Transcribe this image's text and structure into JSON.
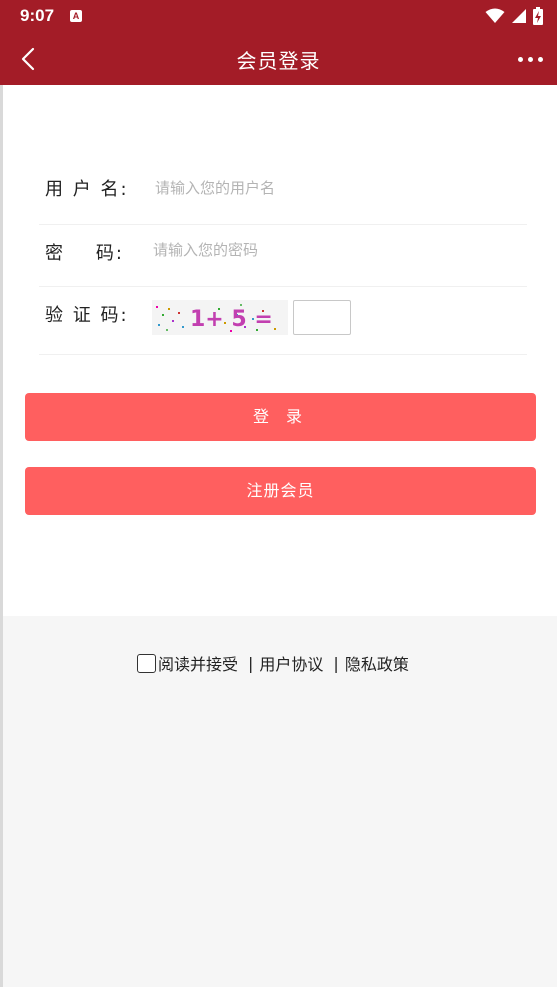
{
  "status_bar": {
    "time": "9:07",
    "notification_badge": "A",
    "icons": [
      "wifi-icon",
      "cellular-signal-icon",
      "battery-charging-icon"
    ]
  },
  "header": {
    "title": "会员登录",
    "back_icon": "chevron-left-icon",
    "more_icon": "more-horizontal-icon"
  },
  "form": {
    "username": {
      "label": "用 户 名:",
      "placeholder": "请输入您的用户名",
      "value": ""
    },
    "password": {
      "label": "密    码:",
      "placeholder": "请输入您的密码",
      "value": ""
    },
    "captcha": {
      "label": "验 证 码:",
      "expression": "1+ 5 =",
      "value": ""
    }
  },
  "buttons": {
    "login": "登 录",
    "register": "注册会员"
  },
  "agreement": {
    "checked": false,
    "text": "阅读并接受",
    "separator": "|",
    "user_agreement": "用户协议",
    "privacy_policy": "隐私政策"
  },
  "colors": {
    "header_bg": "#a31c27",
    "button_bg": "#ff5f5f",
    "footer_bg": "#f6f6f6",
    "captcha_text": "#c23fb0"
  }
}
